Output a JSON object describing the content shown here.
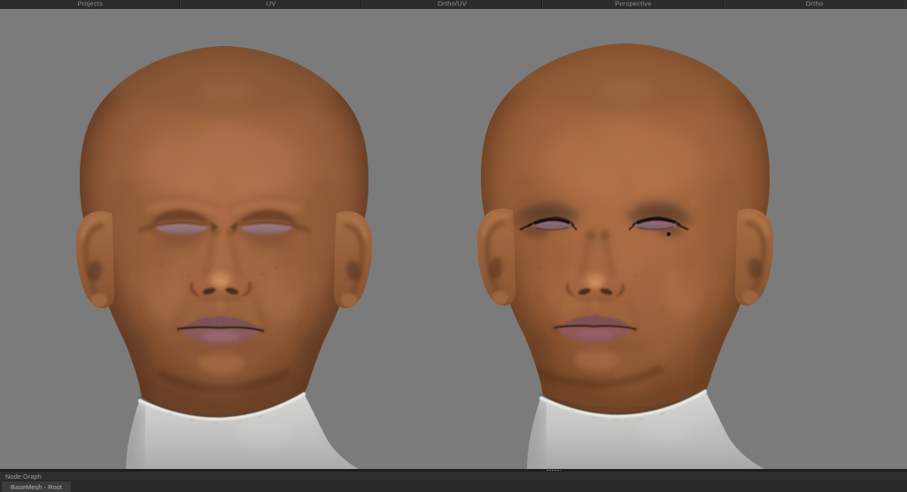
{
  "view_tabs": {
    "items": [
      {
        "label": "Projects"
      },
      {
        "label": "UV"
      },
      {
        "label": "Ortho/UV"
      },
      {
        "label": "Perspective"
      },
      {
        "label": "Ortho"
      }
    ]
  },
  "viewport": {
    "description": "Ortho front view of two bald textured human head busts side by side on a flat grey background; left bust has natural closed-lid skin texture, right bust has dark eye make-up, winged eyeliner, a beauty mark and tinted lips; both sit on white mannequin neck pedestals",
    "background": "#7b7b7b"
  },
  "splitter": {
    "handle_icon": "splitter-dots-icon"
  },
  "node_graph": {
    "title": "Node Graph",
    "tabs": [
      {
        "label": "BaseMesh - Root",
        "active": true
      }
    ]
  },
  "colors": {
    "chrome_bg": "#2c2c2c",
    "viewport_bg": "#7b7b7b",
    "panel_header_bg": "#2e2e2e",
    "tab_text": "#8f8f8f",
    "skin_mid": "#a76e47",
    "pedestal": "#d2d2d0"
  }
}
